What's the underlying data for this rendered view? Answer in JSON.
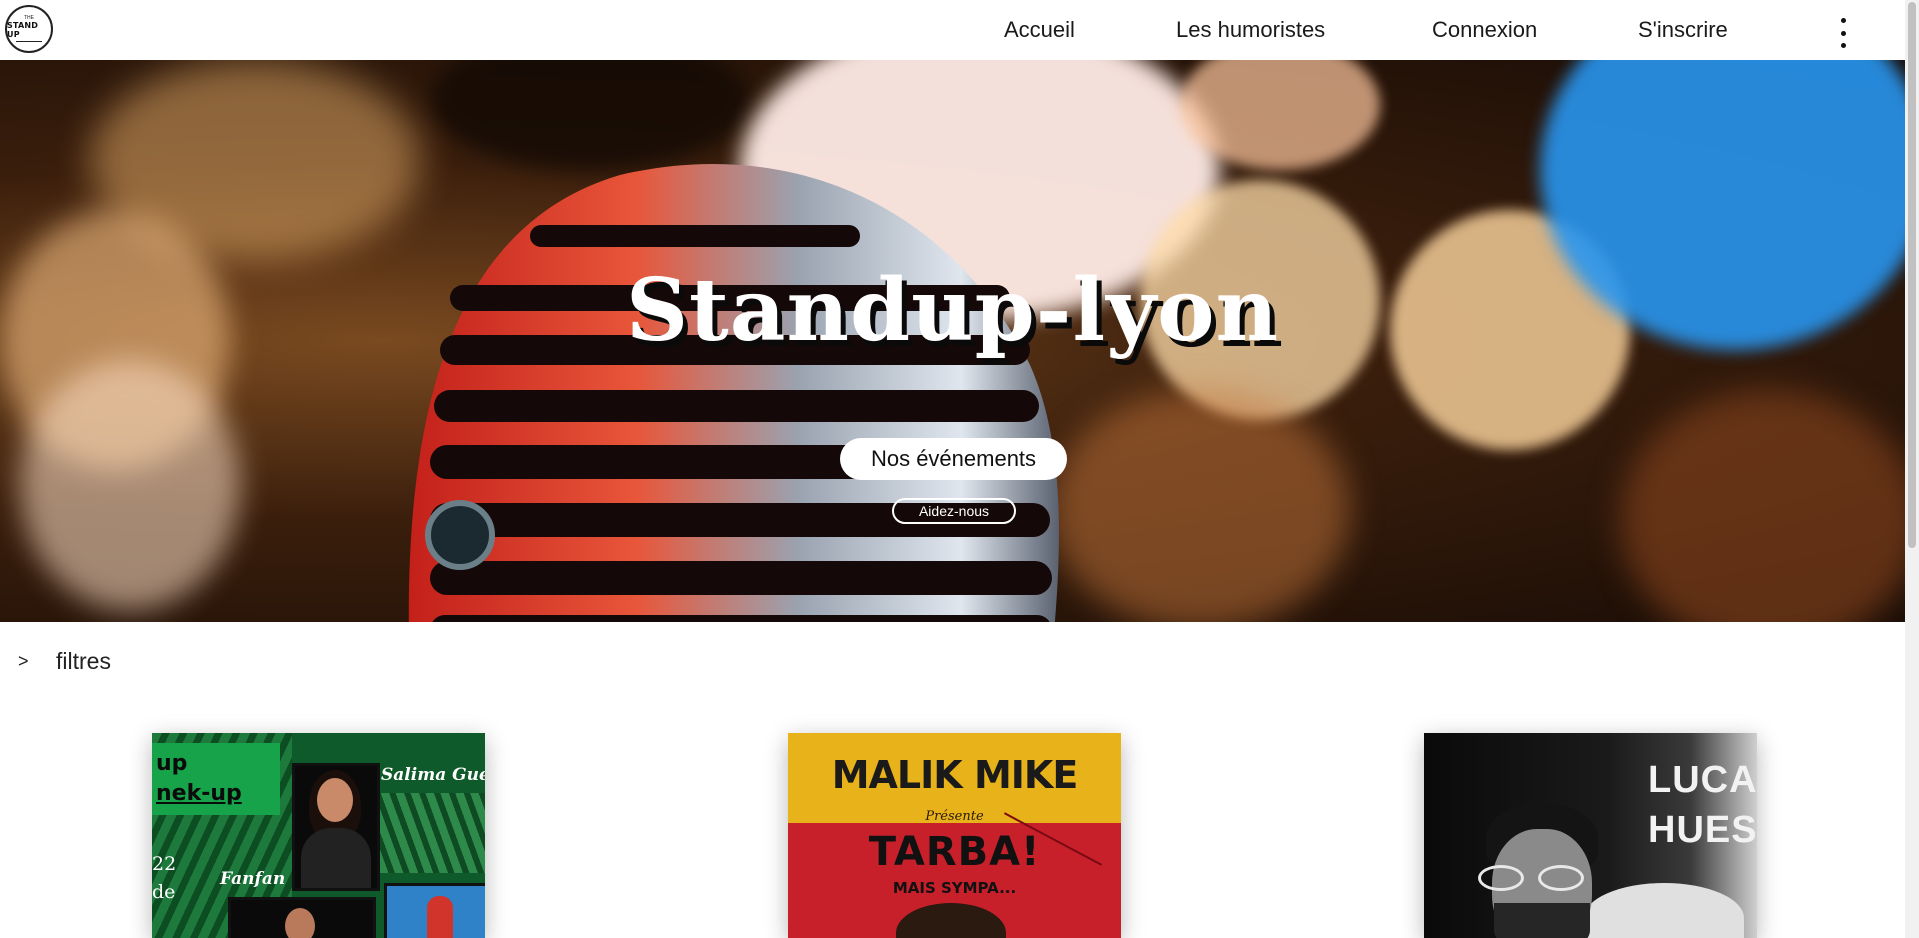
{
  "logo": {
    "top_text": "THE",
    "main_text": "STAND UP"
  },
  "nav": {
    "items": [
      {
        "label": "Accueil"
      },
      {
        "label": "Les humoristes"
      },
      {
        "label": "Connexion"
      },
      {
        "label": "S'inscrire"
      }
    ],
    "menu_icon": "kebab-vertical-icon"
  },
  "hero": {
    "title": "Standup-lyon",
    "primary_button": "Nos événements",
    "secondary_button": "Aidez-nous"
  },
  "filters": {
    "icon": "chevron-right-icon",
    "icon_glyph": ">",
    "label": "filtres"
  },
  "events": [
    {
      "poster_lines": [
        "up",
        "nek-up"
      ],
      "names": [
        "Salima Gue",
        "Fanfan"
      ],
      "date_fragments": [
        "22",
        "de"
      ]
    },
    {
      "title": "MALIK MIKE",
      "subtitle": "Présente",
      "show": "TARBA!",
      "tagline": "MAIS SYMPA..."
    },
    {
      "name_lines": [
        "LUCA",
        "HUES"
      ]
    }
  ],
  "colors": {
    "nav_background": "#ffffff",
    "hero_title": "#ffffff",
    "card1_accent": "#16a34a",
    "card2_accent": "#e8b21a",
    "card2_background": "#c8202a"
  }
}
